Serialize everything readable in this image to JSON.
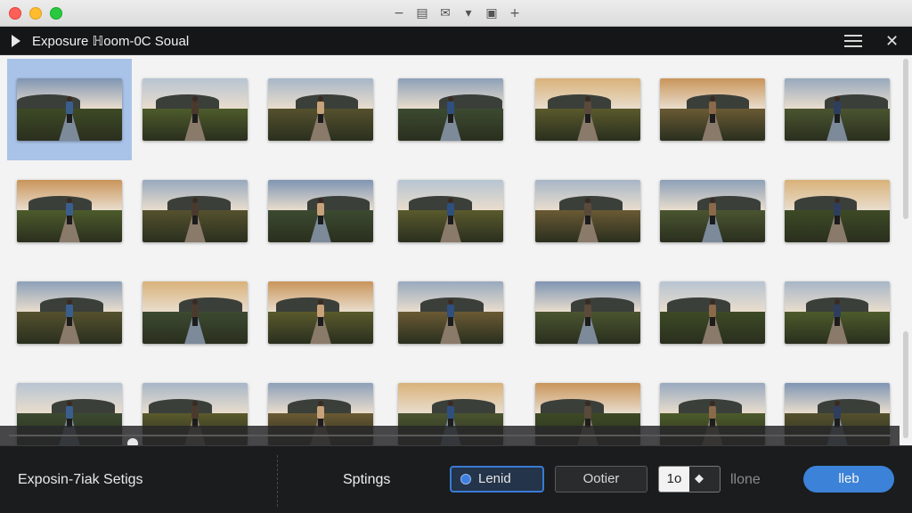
{
  "window": {
    "title_icons": [
      "minus-icon",
      "list-box-icon",
      "mail-icon",
      "chevron-down-icon",
      "briefcase-icon",
      "plus-icon"
    ]
  },
  "header": {
    "title": "Exposure ℍoom-0C Soual"
  },
  "grid": {
    "rows": 4,
    "columns": 7,
    "selected_index": 0,
    "palettes": [
      {
        "sky": "#6b7f98",
        "ground": "#3f4a2a",
        "accent": "#5a6a3a",
        "person": "#4a3a2e"
      },
      {
        "sky": "#c08a52",
        "ground": "#4a5a2c",
        "accent": "#7a6a4a",
        "person": "#2e3e5e"
      }
    ]
  },
  "footer": {
    "left_label": "Exposin-7iak Setigs",
    "settings_label": "Sptings",
    "option_primary": "Lenid",
    "option_secondary": "Ootier",
    "stepper_value": "1o",
    "muted_label": "llone",
    "action_label": "lleb",
    "slider_value": 0.14
  },
  "colors": {
    "accent": "#3b82d8",
    "selection": "#a9c3e8",
    "header_bg": "#151617"
  }
}
